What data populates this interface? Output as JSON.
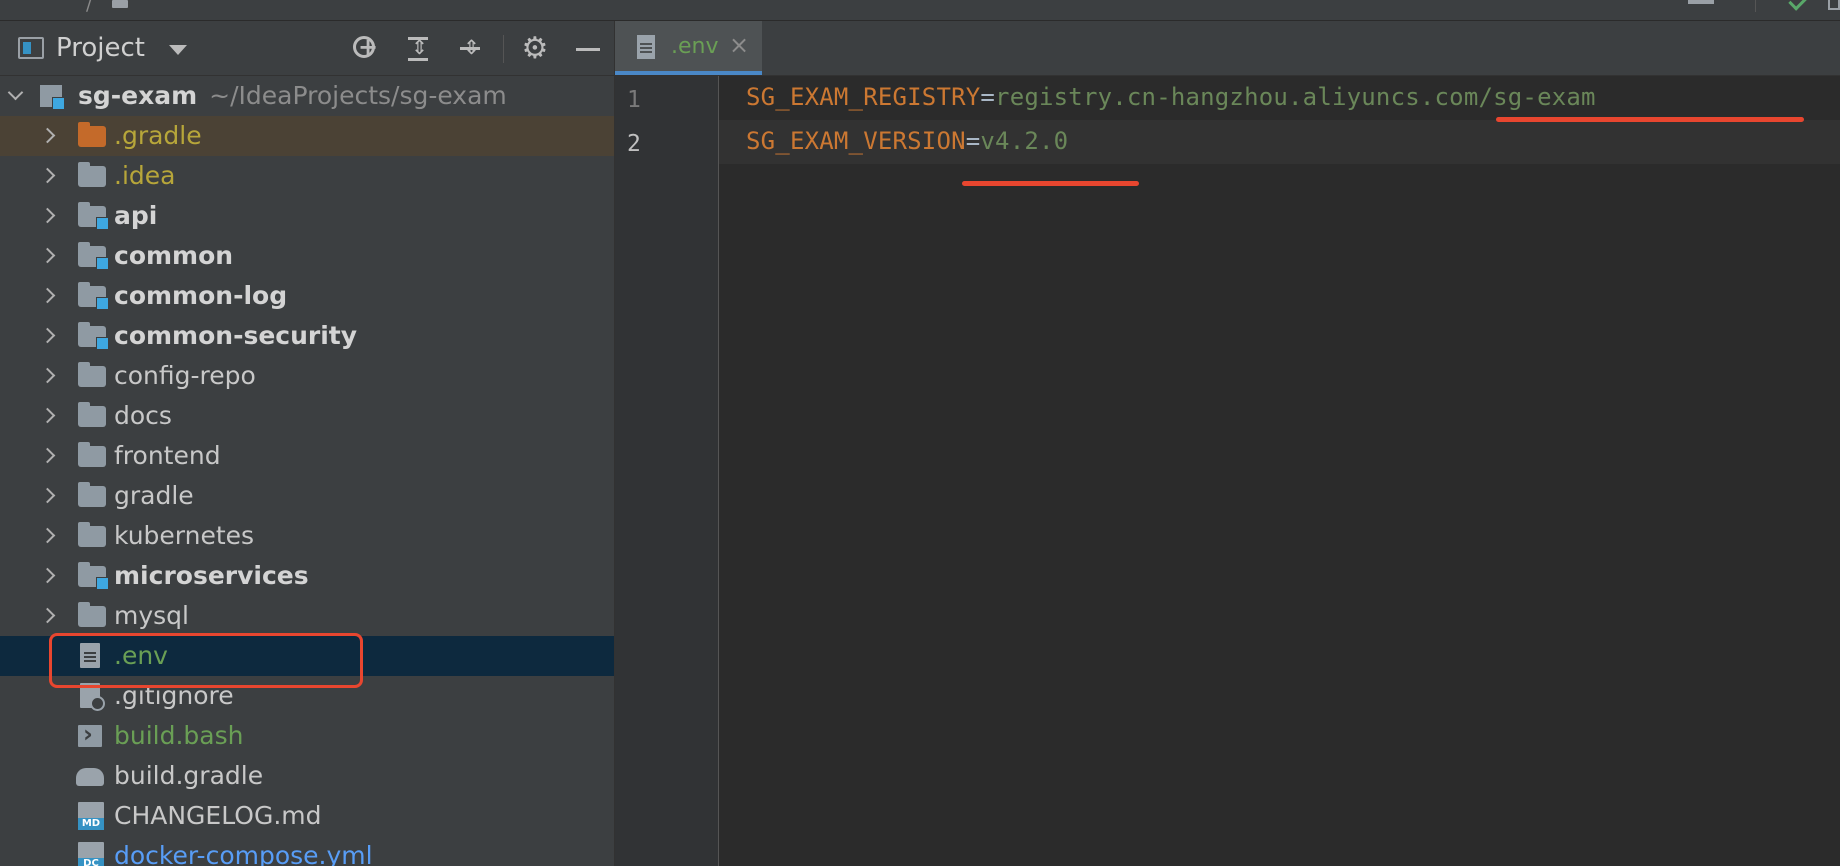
{
  "project_panel": {
    "title": "Project",
    "root": {
      "name": "sg-exam",
      "path": "~/IdeaProjects/sg-exam"
    },
    "items": [
      {
        "label": ".gradle"
      },
      {
        "label": ".idea"
      },
      {
        "label": "api"
      },
      {
        "label": "common"
      },
      {
        "label": "common-log"
      },
      {
        "label": "common-security"
      },
      {
        "label": "config-repo"
      },
      {
        "label": "docs"
      },
      {
        "label": "frontend"
      },
      {
        "label": "gradle"
      },
      {
        "label": "kubernetes"
      },
      {
        "label": "microservices"
      },
      {
        "label": "mysql"
      },
      {
        "label": ".env"
      },
      {
        "label": ".gitignore"
      },
      {
        "label": "build.bash"
      },
      {
        "label": "build.gradle"
      },
      {
        "label": "CHANGELOG.md"
      },
      {
        "label": "docker-compose.yml"
      }
    ]
  },
  "editor": {
    "tab": {
      "label": ".env",
      "close": "×"
    },
    "lines": [
      {
        "number": "1",
        "key": "SG_EXAM_REGISTRY",
        "eq": "=",
        "value": "registry.cn-hangzhou.aliyuncs.com/sg-exam"
      },
      {
        "number": "2",
        "key": "SG_EXAM_VERSION",
        "eq": "=",
        "value": "v4.2.0"
      }
    ]
  },
  "colors": {
    "annotation": "#e8462f",
    "selection": "#0d293e",
    "key": "#cc7832",
    "value": "#6a8759"
  }
}
